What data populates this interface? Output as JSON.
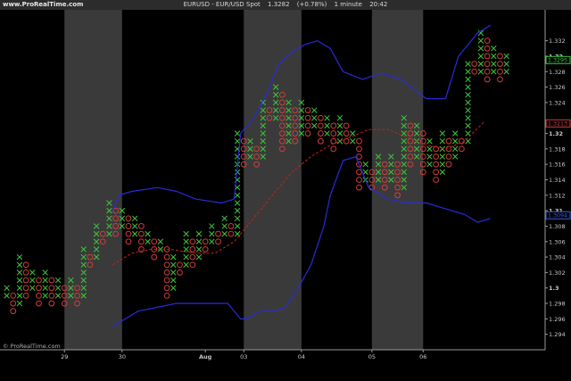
{
  "header": {
    "brand": "www.ProRealTime.com",
    "symbol": "EURUSD - EUR/USD Spot",
    "price": "1.3282",
    "change": "(+0.78%)",
    "interval": "1 minute",
    "time": "20:42"
  },
  "footer": {
    "watermark": "© ProRealTime.com"
  },
  "colors": {
    "background": "#000000",
    "session_band": "#3a3a3a",
    "x_box": "#3cc83c",
    "o_box": "#d23c3c",
    "bollinger": "#2a2ad8",
    "mid_band": "#c81e1e",
    "axis_text": "#c8c8c8"
  },
  "chart_data": {
    "type": "point-and-figure",
    "ylim": [
      1.292,
      1.336
    ],
    "box_size": 0.001,
    "y_ticks": [
      {
        "label": "1.332",
        "v": 1.332,
        "bold": false
      },
      {
        "label": "1.33",
        "v": 1.33,
        "bold": true
      },
      {
        "label": "1.328",
        "v": 1.328,
        "bold": false
      },
      {
        "label": "1.326",
        "v": 1.326,
        "bold": false
      },
      {
        "label": "1.324",
        "v": 1.324,
        "bold": false
      },
      {
        "label": "1.32",
        "v": 1.32,
        "bold": true
      },
      {
        "label": "1.318",
        "v": 1.318,
        "bold": false
      },
      {
        "label": "1.316",
        "v": 1.316,
        "bold": false
      },
      {
        "label": "1.314",
        "v": 1.314,
        "bold": false
      },
      {
        "label": "1.312",
        "v": 1.312,
        "bold": false
      },
      {
        "label": "1.31",
        "v": 1.31,
        "bold": true
      },
      {
        "label": "1.308",
        "v": 1.308,
        "bold": false
      },
      {
        "label": "1.306",
        "v": 1.306,
        "bold": false
      },
      {
        "label": "1.304",
        "v": 1.304,
        "bold": false
      },
      {
        "label": "1.302",
        "v": 1.302,
        "bold": false
      },
      {
        "label": "1.3",
        "v": 1.3,
        "bold": true
      },
      {
        "label": "1.298",
        "v": 1.298,
        "bold": false
      },
      {
        "label": "1.296",
        "v": 1.296,
        "bold": false
      },
      {
        "label": "1.294",
        "v": 1.294,
        "bold": false
      }
    ],
    "price_tags": [
      {
        "label": "1.3295",
        "v": 1.3295,
        "color": "#3cc83c"
      },
      {
        "label": "1.3213",
        "v": 1.3213,
        "color": "#d23c3c"
      },
      {
        "label": "1.3094",
        "v": 1.3094,
        "color": "#3a5ad8"
      }
    ],
    "x_labels": [
      {
        "label": "29",
        "c": 9.5
      },
      {
        "label": "30",
        "c": 18.5
      },
      {
        "label": "Aug",
        "c": 31.5
      },
      {
        "label": "03",
        "c": 37.5
      },
      {
        "label": "04",
        "c": 46.5
      },
      {
        "label": "05",
        "c": 57.5
      },
      {
        "label": "06",
        "c": 65.5
      }
    ],
    "session_bands": [
      [
        9.5,
        18.5
      ],
      [
        37.5,
        46.5
      ],
      [
        57.5,
        65.5
      ]
    ],
    "columns": [
      {
        "t": "X",
        "lo": 1.299,
        "hi": 1.3
      },
      {
        "t": "O",
        "lo": 1.297,
        "hi": 1.299
      },
      {
        "t": "X",
        "lo": 1.298,
        "hi": 1.304
      },
      {
        "t": "O",
        "lo": 1.299,
        "hi": 1.303
      },
      {
        "t": "X",
        "lo": 1.3,
        "hi": 1.302
      },
      {
        "t": "O",
        "lo": 1.298,
        "hi": 1.301
      },
      {
        "t": "X",
        "lo": 1.299,
        "hi": 1.302
      },
      {
        "t": "O",
        "lo": 1.298,
        "hi": 1.301
      },
      {
        "t": "X",
        "lo": 1.299,
        "hi": 1.301
      },
      {
        "t": "O",
        "lo": 1.298,
        "hi": 1.3
      },
      {
        "t": "X",
        "lo": 1.299,
        "hi": 1.301
      },
      {
        "t": "O",
        "lo": 1.298,
        "hi": 1.3
      },
      {
        "t": "X",
        "lo": 1.299,
        "hi": 1.305
      },
      {
        "t": "O",
        "lo": 1.303,
        "hi": 1.304
      },
      {
        "t": "X",
        "lo": 1.304,
        "hi": 1.308
      },
      {
        "t": "O",
        "lo": 1.306,
        "hi": 1.307
      },
      {
        "t": "X",
        "lo": 1.307,
        "hi": 1.311
      },
      {
        "t": "O",
        "lo": 1.307,
        "hi": 1.31
      },
      {
        "t": "X",
        "lo": 1.308,
        "hi": 1.31
      },
      {
        "t": "O",
        "lo": 1.306,
        "hi": 1.309
      },
      {
        "t": "X",
        "lo": 1.307,
        "hi": 1.309
      },
      {
        "t": "O",
        "lo": 1.305,
        "hi": 1.308
      },
      {
        "t": "X",
        "lo": 1.306,
        "hi": 1.307
      },
      {
        "t": "O",
        "lo": 1.304,
        "hi": 1.306
      },
      {
        "t": "X",
        "lo": 1.305,
        "hi": 1.306
      },
      {
        "t": "O",
        "lo": 1.299,
        "hi": 1.305
      },
      {
        "t": "X",
        "lo": 1.3,
        "hi": 1.304
      },
      {
        "t": "O",
        "lo": 1.302,
        "hi": 1.303
      },
      {
        "t": "X",
        "lo": 1.303,
        "hi": 1.307
      },
      {
        "t": "O",
        "lo": 1.303,
        "hi": 1.306
      },
      {
        "t": "X",
        "lo": 1.304,
        "hi": 1.307
      },
      {
        "t": "O",
        "lo": 1.305,
        "hi": 1.306
      },
      {
        "t": "X",
        "lo": 1.306,
        "hi": 1.308
      },
      {
        "t": "O",
        "lo": 1.306,
        "hi": 1.307
      },
      {
        "t": "X",
        "lo": 1.307,
        "hi": 1.309
      },
      {
        "t": "O",
        "lo": 1.307,
        "hi": 1.308
      },
      {
        "t": "X",
        "lo": 1.307,
        "hi": 1.32
      },
      {
        "t": "O",
        "lo": 1.316,
        "hi": 1.319
      },
      {
        "t": "X",
        "lo": 1.317,
        "hi": 1.319
      },
      {
        "t": "O",
        "lo": 1.316,
        "hi": 1.318
      },
      {
        "t": "X",
        "lo": 1.317,
        "hi": 1.324
      },
      {
        "t": "O",
        "lo": 1.322,
        "hi": 1.323
      },
      {
        "t": "X",
        "lo": 1.322,
        "hi": 1.326
      },
      {
        "t": "O",
        "lo": 1.318,
        "hi": 1.325
      },
      {
        "t": "X",
        "lo": 1.319,
        "hi": 1.324
      },
      {
        "t": "O",
        "lo": 1.319,
        "hi": 1.323
      },
      {
        "t": "X",
        "lo": 1.32,
        "hi": 1.324
      },
      {
        "t": "O",
        "lo": 1.32,
        "hi": 1.323
      },
      {
        "t": "X",
        "lo": 1.321,
        "hi": 1.323
      },
      {
        "t": "O",
        "lo": 1.319,
        "hi": 1.322
      },
      {
        "t": "X",
        "lo": 1.32,
        "hi": 1.322
      },
      {
        "t": "O",
        "lo": 1.318,
        "hi": 1.321
      },
      {
        "t": "X",
        "lo": 1.319,
        "hi": 1.322
      },
      {
        "t": "O",
        "lo": 1.319,
        "hi": 1.321
      },
      {
        "t": "X",
        "lo": 1.319,
        "hi": 1.32
      },
      {
        "t": "O",
        "lo": 1.313,
        "hi": 1.319
      },
      {
        "t": "X",
        "lo": 1.314,
        "hi": 1.316
      },
      {
        "t": "O",
        "lo": 1.313,
        "hi": 1.315
      },
      {
        "t": "X",
        "lo": 1.314,
        "hi": 1.317
      },
      {
        "t": "O",
        "lo": 1.313,
        "hi": 1.316
      },
      {
        "t": "X",
        "lo": 1.314,
        "hi": 1.317
      },
      {
        "t": "O",
        "lo": 1.312,
        "hi": 1.316
      },
      {
        "t": "X",
        "lo": 1.313,
        "hi": 1.322
      },
      {
        "t": "O",
        "lo": 1.316,
        "hi": 1.321
      },
      {
        "t": "X",
        "lo": 1.317,
        "hi": 1.321
      },
      {
        "t": "O",
        "lo": 1.315,
        "hi": 1.32
      },
      {
        "t": "X",
        "lo": 1.316,
        "hi": 1.319
      },
      {
        "t": "O",
        "lo": 1.314,
        "hi": 1.318
      },
      {
        "t": "X",
        "lo": 1.315,
        "hi": 1.32
      },
      {
        "t": "O",
        "lo": 1.316,
        "hi": 1.319
      },
      {
        "t": "X",
        "lo": 1.317,
        "hi": 1.32
      },
      {
        "t": "O",
        "lo": 1.318,
        "hi": 1.319
      },
      {
        "t": "X",
        "lo": 1.319,
        "hi": 1.329
      },
      {
        "t": "O",
        "lo": 1.328,
        "hi": 1.329
      },
      {
        "t": "X",
        "lo": 1.328,
        "hi": 1.333
      },
      {
        "t": "O",
        "lo": 1.327,
        "hi": 1.332
      },
      {
        "t": "X",
        "lo": 1.328,
        "hi": 1.331
      },
      {
        "t": "O",
        "lo": 1.327,
        "hi": 1.33
      },
      {
        "t": "X",
        "lo": 1.328,
        "hi": 1.33
      }
    ],
    "upper_band": [
      [
        17,
        1.31
      ],
      [
        18,
        1.312
      ],
      [
        20,
        1.3125
      ],
      [
        24,
        1.313
      ],
      [
        27,
        1.3125
      ],
      [
        30,
        1.3115
      ],
      [
        34,
        1.311
      ],
      [
        36,
        1.3115
      ],
      [
        37,
        1.32
      ],
      [
        39,
        1.322
      ],
      [
        41,
        1.325
      ],
      [
        43,
        1.329
      ],
      [
        45,
        1.3305
      ],
      [
        47,
        1.3315
      ],
      [
        49,
        1.332
      ],
      [
        51,
        1.331
      ],
      [
        53,
        1.328
      ],
      [
        56,
        1.327
      ],
      [
        59,
        1.3278
      ],
      [
        62,
        1.327
      ],
      [
        66,
        1.3245
      ],
      [
        69,
        1.3245
      ],
      [
        71,
        1.33
      ],
      [
        74,
        1.333
      ],
      [
        76,
        1.334
      ]
    ],
    "lower_band": [
      [
        17,
        1.295
      ],
      [
        19,
        1.296
      ],
      [
        21,
        1.297
      ],
      [
        24,
        1.2975
      ],
      [
        27,
        1.298
      ],
      [
        30,
        1.298
      ],
      [
        33,
        1.298
      ],
      [
        35,
        1.298
      ],
      [
        36,
        1.297
      ],
      [
        37,
        1.296
      ],
      [
        38,
        1.296
      ],
      [
        40,
        1.297
      ],
      [
        42,
        1.297
      ],
      [
        44,
        1.2975
      ],
      [
        46,
        1.3
      ],
      [
        48,
        1.303
      ],
      [
        50,
        1.308
      ],
      [
        51,
        1.312
      ],
      [
        53,
        1.3165
      ],
      [
        55,
        1.317
      ],
      [
        57,
        1.313
      ],
      [
        60,
        1.3115
      ],
      [
        63,
        1.311
      ],
      [
        66,
        1.311
      ],
      [
        68,
        1.3105
      ],
      [
        70,
        1.31
      ],
      [
        72,
        1.3095
      ],
      [
        74,
        1.3085
      ],
      [
        76,
        1.309
      ]
    ],
    "mid_band": [
      [
        17,
        1.303
      ],
      [
        20,
        1.3045
      ],
      [
        23,
        1.305
      ],
      [
        26,
        1.305
      ],
      [
        30,
        1.3045
      ],
      [
        33,
        1.3045
      ],
      [
        36,
        1.306
      ],
      [
        39,
        1.309
      ],
      [
        42,
        1.312
      ],
      [
        45,
        1.315
      ],
      [
        48,
        1.317
      ],
      [
        51,
        1.3185
      ],
      [
        54,
        1.3195
      ],
      [
        57,
        1.3205
      ],
      [
        60,
        1.3205
      ],
      [
        63,
        1.3195
      ],
      [
        66,
        1.3185
      ],
      [
        69,
        1.318
      ],
      [
        72,
        1.319
      ],
      [
        75,
        1.3215
      ]
    ]
  }
}
